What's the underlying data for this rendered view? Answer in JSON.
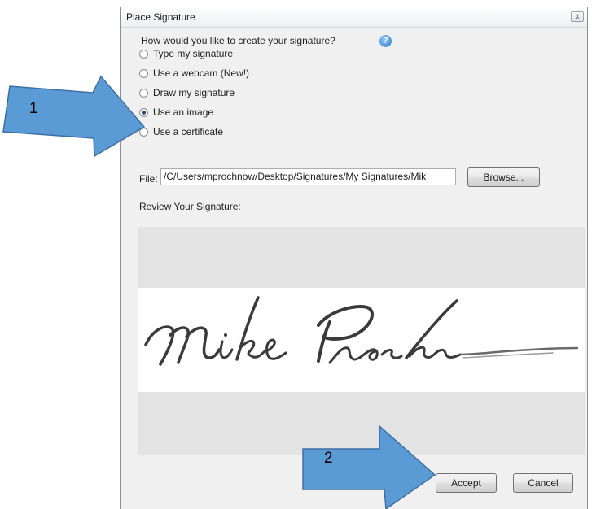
{
  "dialog": {
    "title": "Place Signature",
    "close_glyph": "x",
    "question": "How would you like to create your signature?",
    "help_icon": "question-circle-icon",
    "options": [
      {
        "label": "Type my signature",
        "checked": false
      },
      {
        "label": "Use a webcam (New!)",
        "checked": false
      },
      {
        "label": "Draw my signature",
        "checked": false
      },
      {
        "label": "Use an image",
        "checked": true
      },
      {
        "label": "Use a certificate",
        "checked": false
      }
    ],
    "file_label": "File:",
    "file_value": "/C/Users/mprochnow/Desktop/Signatures/My Signatures/Mik",
    "browse_label": "Browse...",
    "review_label": "Review Your Signature:",
    "accept_label": "Accept",
    "cancel_label": "Cancel"
  },
  "annotations": {
    "callout_1": "1",
    "callout_2": "2",
    "arrow_color": "#5b9bd5",
    "arrow_border": "#3e6fa3"
  },
  "colors": {
    "dialog_bg": "#f0f0f0",
    "preview_bg": "#e3e3e3",
    "radio_dot": "#27476e",
    "help_blue": "#2d7bd1"
  }
}
